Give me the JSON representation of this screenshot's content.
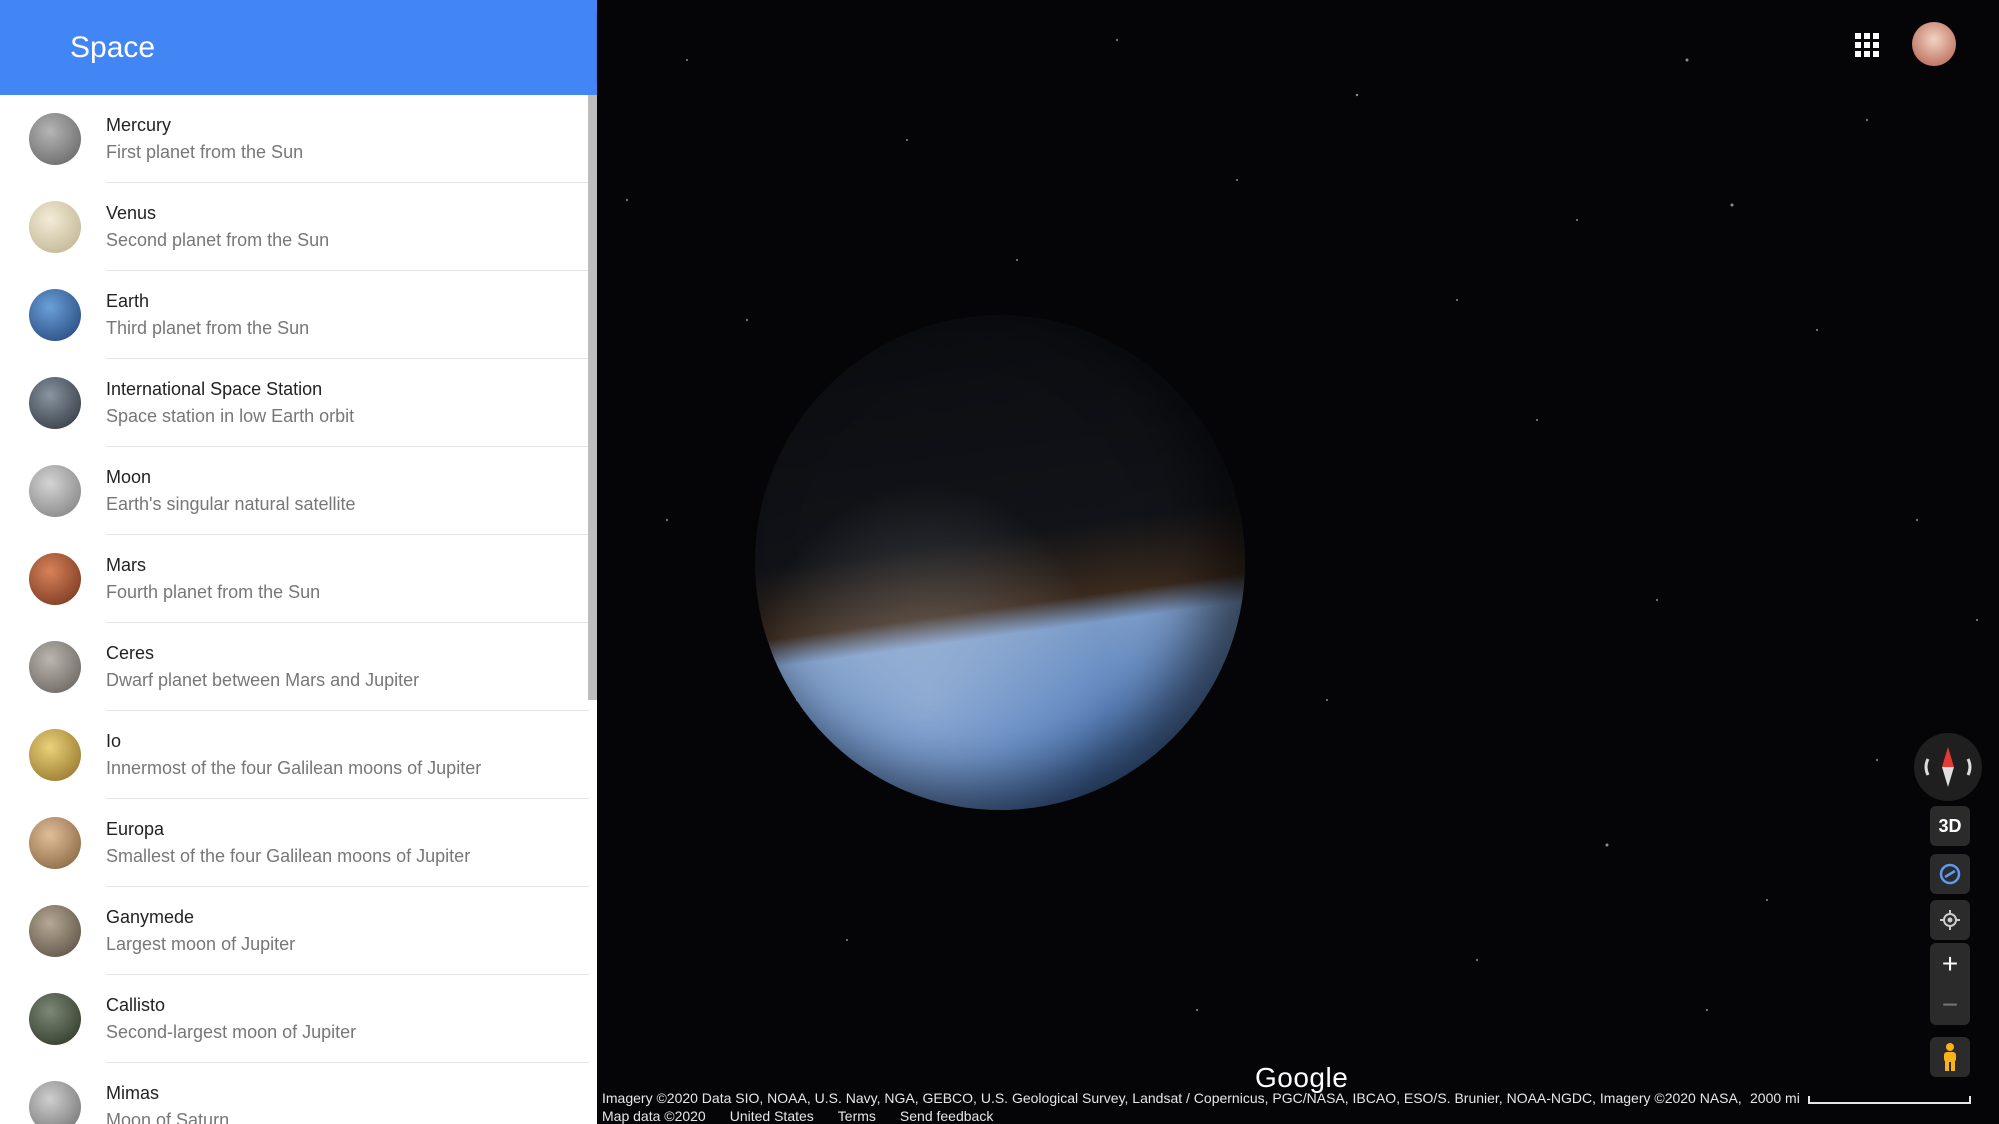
{
  "sidebar": {
    "title": "Space",
    "items": [
      {
        "name": "Mercury",
        "desc": "First planet from the Sun",
        "color": "#8a8a8a"
      },
      {
        "name": "Venus",
        "desc": "Second planet from the Sun",
        "color": "#d9cfb0"
      },
      {
        "name": "Earth",
        "desc": "Third planet from the Sun",
        "color": "#3a6aa8"
      },
      {
        "name": "International Space Station",
        "desc": "Space station in low Earth orbit",
        "color": "#556270"
      },
      {
        "name": "Moon",
        "desc": "Earth's singular natural satellite",
        "color": "#a8a8a8"
      },
      {
        "name": "Mars",
        "desc": "Fourth planet from the Sun",
        "color": "#a8522e"
      },
      {
        "name": "Ceres",
        "desc": "Dwarf planet between Mars and Jupiter",
        "color": "#8f8a86"
      },
      {
        "name": "Io",
        "desc": "Innermost of the four Galilean moons of Jupiter",
        "color": "#c9a84a"
      },
      {
        "name": "Europa",
        "desc": "Smallest of the four Galilean moons of Jupiter",
        "color": "#b8936b"
      },
      {
        "name": "Ganymede",
        "desc": "Largest moon of Jupiter",
        "color": "#8b7d6b"
      },
      {
        "name": "Callisto",
        "desc": "Second-largest moon of Jupiter",
        "color": "#4d5747"
      },
      {
        "name": "Mimas",
        "desc": "Moon of Saturn",
        "color": "#9a9a9a"
      }
    ]
  },
  "controls": {
    "view_3d_label": "3D",
    "zoom_in_label": "+",
    "zoom_out_label": "−"
  },
  "map": {
    "logo": "Google",
    "attribution": "Imagery ©2020 Data SIO, NOAA, U.S. Navy, NGA, GEBCO, U.S. Geological Survey, Landsat / Copernicus, PGC/NASA, IBCAO, ESO/S. Brunier, NOAA-NGDC, Imagery ©2020 NASA,",
    "map_data": "Map data ©2020",
    "region": "United States",
    "terms": "Terms",
    "feedback": "Send feedback",
    "scale": "2000 mi"
  },
  "colors": {
    "header": "#4285f4",
    "compass_needle": "#e53935"
  }
}
